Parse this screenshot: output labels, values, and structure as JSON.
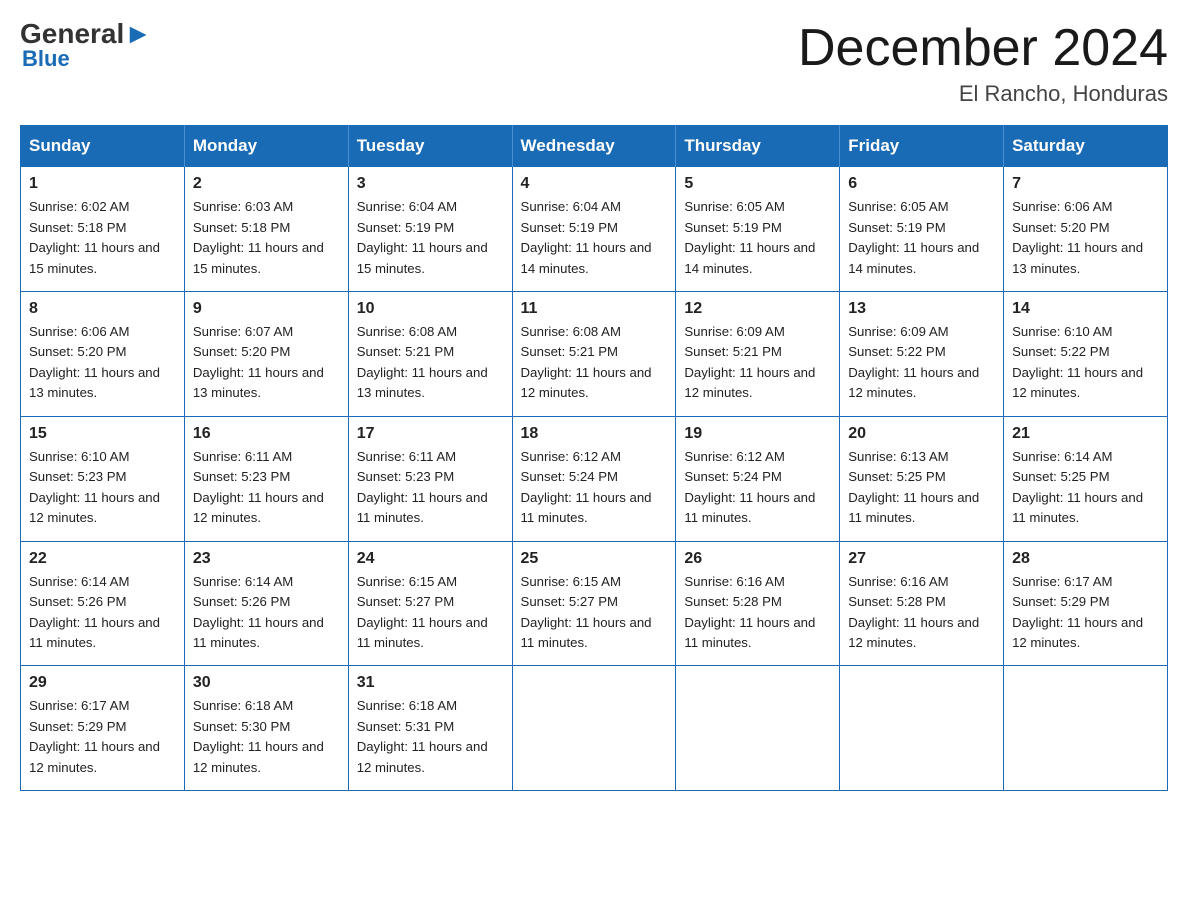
{
  "header": {
    "logo_general": "General",
    "logo_blue": "Blue",
    "month_year": "December 2024",
    "location": "El Rancho, Honduras"
  },
  "days_of_week": [
    "Sunday",
    "Monday",
    "Tuesday",
    "Wednesday",
    "Thursday",
    "Friday",
    "Saturday"
  ],
  "weeks": [
    [
      {
        "day": "1",
        "sunrise": "6:02 AM",
        "sunset": "5:18 PM",
        "daylight": "11 hours and 15 minutes."
      },
      {
        "day": "2",
        "sunrise": "6:03 AM",
        "sunset": "5:18 PM",
        "daylight": "11 hours and 15 minutes."
      },
      {
        "day": "3",
        "sunrise": "6:04 AM",
        "sunset": "5:19 PM",
        "daylight": "11 hours and 15 minutes."
      },
      {
        "day": "4",
        "sunrise": "6:04 AM",
        "sunset": "5:19 PM",
        "daylight": "11 hours and 14 minutes."
      },
      {
        "day": "5",
        "sunrise": "6:05 AM",
        "sunset": "5:19 PM",
        "daylight": "11 hours and 14 minutes."
      },
      {
        "day": "6",
        "sunrise": "6:05 AM",
        "sunset": "5:19 PM",
        "daylight": "11 hours and 14 minutes."
      },
      {
        "day": "7",
        "sunrise": "6:06 AM",
        "sunset": "5:20 PM",
        "daylight": "11 hours and 13 minutes."
      }
    ],
    [
      {
        "day": "8",
        "sunrise": "6:06 AM",
        "sunset": "5:20 PM",
        "daylight": "11 hours and 13 minutes."
      },
      {
        "day": "9",
        "sunrise": "6:07 AM",
        "sunset": "5:20 PM",
        "daylight": "11 hours and 13 minutes."
      },
      {
        "day": "10",
        "sunrise": "6:08 AM",
        "sunset": "5:21 PM",
        "daylight": "11 hours and 13 minutes."
      },
      {
        "day": "11",
        "sunrise": "6:08 AM",
        "sunset": "5:21 PM",
        "daylight": "11 hours and 12 minutes."
      },
      {
        "day": "12",
        "sunrise": "6:09 AM",
        "sunset": "5:21 PM",
        "daylight": "11 hours and 12 minutes."
      },
      {
        "day": "13",
        "sunrise": "6:09 AM",
        "sunset": "5:22 PM",
        "daylight": "11 hours and 12 minutes."
      },
      {
        "day": "14",
        "sunrise": "6:10 AM",
        "sunset": "5:22 PM",
        "daylight": "11 hours and 12 minutes."
      }
    ],
    [
      {
        "day": "15",
        "sunrise": "6:10 AM",
        "sunset": "5:23 PM",
        "daylight": "11 hours and 12 minutes."
      },
      {
        "day": "16",
        "sunrise": "6:11 AM",
        "sunset": "5:23 PM",
        "daylight": "11 hours and 12 minutes."
      },
      {
        "day": "17",
        "sunrise": "6:11 AM",
        "sunset": "5:23 PM",
        "daylight": "11 hours and 11 minutes."
      },
      {
        "day": "18",
        "sunrise": "6:12 AM",
        "sunset": "5:24 PM",
        "daylight": "11 hours and 11 minutes."
      },
      {
        "day": "19",
        "sunrise": "6:12 AM",
        "sunset": "5:24 PM",
        "daylight": "11 hours and 11 minutes."
      },
      {
        "day": "20",
        "sunrise": "6:13 AM",
        "sunset": "5:25 PM",
        "daylight": "11 hours and 11 minutes."
      },
      {
        "day": "21",
        "sunrise": "6:14 AM",
        "sunset": "5:25 PM",
        "daylight": "11 hours and 11 minutes."
      }
    ],
    [
      {
        "day": "22",
        "sunrise": "6:14 AM",
        "sunset": "5:26 PM",
        "daylight": "11 hours and 11 minutes."
      },
      {
        "day": "23",
        "sunrise": "6:14 AM",
        "sunset": "5:26 PM",
        "daylight": "11 hours and 11 minutes."
      },
      {
        "day": "24",
        "sunrise": "6:15 AM",
        "sunset": "5:27 PM",
        "daylight": "11 hours and 11 minutes."
      },
      {
        "day": "25",
        "sunrise": "6:15 AM",
        "sunset": "5:27 PM",
        "daylight": "11 hours and 11 minutes."
      },
      {
        "day": "26",
        "sunrise": "6:16 AM",
        "sunset": "5:28 PM",
        "daylight": "11 hours and 11 minutes."
      },
      {
        "day": "27",
        "sunrise": "6:16 AM",
        "sunset": "5:28 PM",
        "daylight": "11 hours and 12 minutes."
      },
      {
        "day": "28",
        "sunrise": "6:17 AM",
        "sunset": "5:29 PM",
        "daylight": "11 hours and 12 minutes."
      }
    ],
    [
      {
        "day": "29",
        "sunrise": "6:17 AM",
        "sunset": "5:29 PM",
        "daylight": "11 hours and 12 minutes."
      },
      {
        "day": "30",
        "sunrise": "6:18 AM",
        "sunset": "5:30 PM",
        "daylight": "11 hours and 12 minutes."
      },
      {
        "day": "31",
        "sunrise": "6:18 AM",
        "sunset": "5:31 PM",
        "daylight": "11 hours and 12 minutes."
      },
      null,
      null,
      null,
      null
    ]
  ],
  "labels": {
    "sunrise_prefix": "Sunrise: ",
    "sunset_prefix": "Sunset: ",
    "daylight_prefix": "Daylight: "
  }
}
